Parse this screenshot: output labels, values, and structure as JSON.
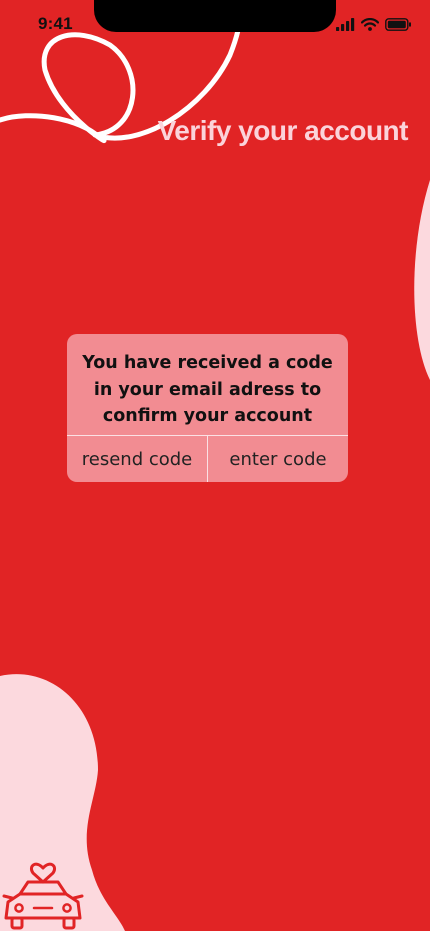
{
  "status_bar": {
    "time": "9:41"
  },
  "header": {
    "title": "Verify your account"
  },
  "dialog": {
    "message": "You have received a code in your email adress to confirm your account",
    "resend_label": "resend code",
    "enter_label": "enter code"
  },
  "colors": {
    "background": "#e12425",
    "blob": "#fcd9de",
    "dialog": "#f28c92",
    "title": "#fbd3da"
  },
  "icons": {
    "logo": "car-heart-icon",
    "signal": "cellular-signal-icon",
    "wifi": "wifi-icon",
    "battery": "battery-icon"
  }
}
